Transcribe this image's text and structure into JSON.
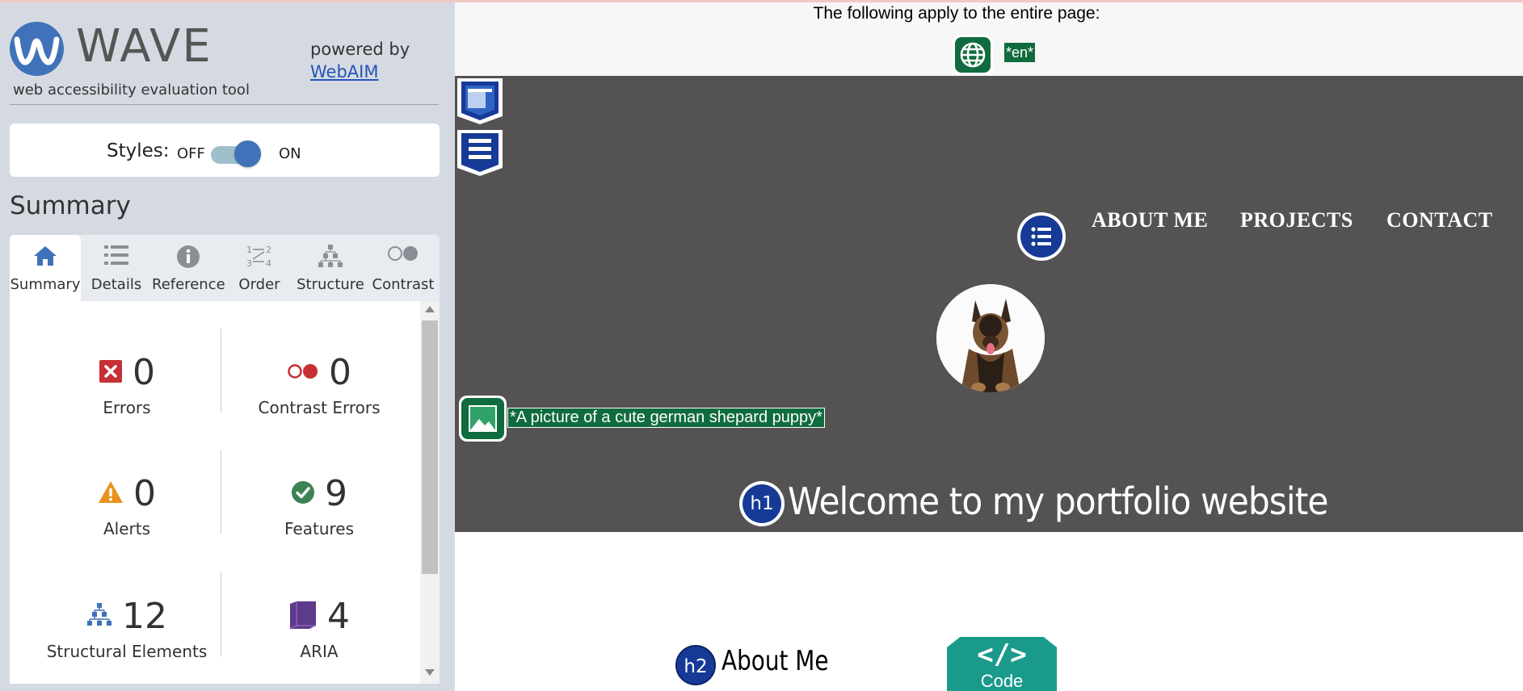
{
  "wave": {
    "title": "WAVE",
    "subtitle": "web accessibility evaluation tool",
    "powered_by": "powered by",
    "webaim_link": "WebAIM",
    "styles": {
      "label": "Styles:",
      "off": "OFF",
      "on": "ON",
      "state": "on"
    },
    "summary_heading": "Summary",
    "tabs": [
      {
        "label": "Summary",
        "icon": "home-icon",
        "active": true
      },
      {
        "label": "Details",
        "icon": "list-icon",
        "active": false
      },
      {
        "label": "Reference",
        "icon": "info-icon",
        "active": false
      },
      {
        "label": "Order",
        "icon": "order-icon",
        "active": false
      },
      {
        "label": "Structure",
        "icon": "structure-icon",
        "active": false
      },
      {
        "label": "Contrast",
        "icon": "contrast-icon",
        "active": false
      }
    ],
    "stats": {
      "errors": {
        "count": "0",
        "label": "Errors"
      },
      "contrast_errors": {
        "count": "0",
        "label": "Contrast Errors"
      },
      "alerts": {
        "count": "0",
        "label": "Alerts"
      },
      "features": {
        "count": "9",
        "label": "Features"
      },
      "structural": {
        "count": "12",
        "label": "Structural Elements"
      },
      "aria": {
        "count": "4",
        "label": "ARIA"
      }
    },
    "colors": {
      "brand": "#3f72b9",
      "error": "#c62f34",
      "alert": "#e8931e",
      "feature": "#3d8253",
      "structure": "#3f72b9",
      "aria": "#5e3a8b"
    }
  },
  "page": {
    "apply_text": "The following apply to the entire page:",
    "lang_badge": "*en*",
    "nav": [
      "ABOUT ME",
      "PROJECTS",
      "CONTACT"
    ],
    "image_alt": "*A picture of a cute german shepard puppy*",
    "h1_tag": "h1",
    "hero_title": "Welcome to my portfolio website",
    "h2_tag": "h2",
    "about_heading": "About Me",
    "code_symbol": "</>",
    "code_label": "Code",
    "colors": {
      "hero_bg": "#545253",
      "feature_green": "#106c3e",
      "structure_blue": "#163a96",
      "code_teal": "#1a9a8a"
    }
  }
}
